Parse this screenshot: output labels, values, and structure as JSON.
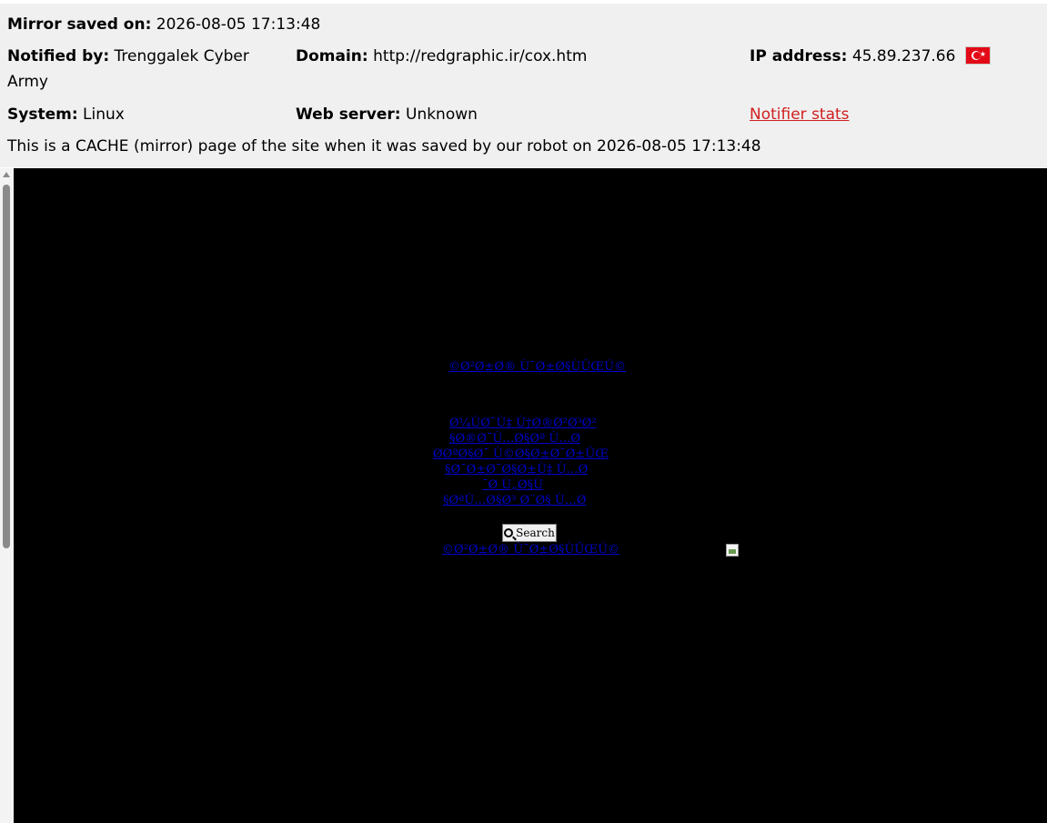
{
  "header": {
    "mirror_saved_label": "Mirror saved on:",
    "mirror_saved_value": "2026-08-05 17:13:48",
    "notified_by_label": "Notified by:",
    "notified_by_line1": "Trenggalek Cyber",
    "notified_by_line2": "Army",
    "domain_label": "Domain:",
    "domain_value": "http://redgraphic.ir/cox.htm",
    "ip_label": "IP address:",
    "ip_value": "45.89.237.66",
    "flag_icon": "turkey-flag-icon",
    "system_label": "System:",
    "system_value": "Linux",
    "web_server_label": "Web server:",
    "web_server_value": "Unknown",
    "notifier_stats_link": "Notifier stats",
    "cache_notice": "This is a CACHE (mirror) page of the site when it was saved by our robot on 2026-08-05 17:13:48"
  },
  "mirror": {
    "background": "#000000",
    "link_color": "#0000cc",
    "top_link": "©Ø²Ø±Ø® Ù¯Ø±Ø§ÙÛŒÚ©",
    "links": [
      "Ø¼ÙØ¯Ù‡ Ù†Ø®Ø²Ø³Ø²",
      "§Ø®Ø¯Ù…Ø§Øª Ù…Ø",
      "ØØªØ§Ø¯ Ù©Ø§Ø±Ø¯Ø±ÛŒ",
      "§Ø¯Ø±Ø¯Ø§Ø±Ù‡ Ù…Ø",
      "¯Ø Ù„Ø§Ù",
      "§ØªÙ…Ø§Ø³ Ø¨Ø§ Ù…Ø"
    ],
    "search_label": "Search",
    "search_icon": "search-icon",
    "bottom_link": "©Ø²Ø±Ø® Ù¯Ø±Ø§ÙÛŒÚ©",
    "broken_image_icon": "broken-image-icon"
  }
}
